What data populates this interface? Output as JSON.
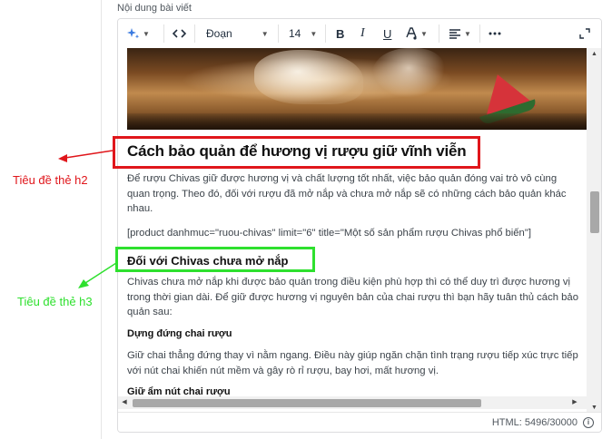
{
  "field": {
    "label": "Nội dung bài viết"
  },
  "toolbar": {
    "block_format": "Đoạn",
    "font_size": "14",
    "bold": "B",
    "italic": "I",
    "underline": "U",
    "icons": [
      "ai-assistant-icon",
      "source-code-icon",
      "text-color-icon",
      "align-icon",
      "more-icon",
      "fullscreen-icon"
    ]
  },
  "article": {
    "heading_h2": "Cách bảo quản để hương vị rượu giữ vĩnh viễn",
    "para1": "Để rượu Chivas giữ được hương vị và chất lượng tốt nhất, việc bảo quản đóng vai trò vô cùng quan trọng. Theo đó, đối với rượu đã mở nắp và chưa mở nắp sẽ có những cách bảo quản khác nhau.",
    "shortcode": "[product danhmuc=\"ruou-chivas\" limit=\"6\" title=\"Một số sản phẩm rượu  Chivas phổ biến\"]",
    "heading_h3": "Đối với Chivas chưa mở nắp",
    "para2": "Chivas chưa mở nắp khi được bảo quản trong điều kiện phù hợp thì có thể duy trì được hương vị trong thời gian dài. Để giữ được hương vị nguyên bản của chai rượu thì bạn hãy tuân thủ cách bảo quản sau:",
    "heading_h4a": "Dựng đứng chai rượu",
    "para3": "Giữ chai thẳng đứng thay vì nằm ngang. Điều này giúp ngăn chặn tình trạng rượu tiếp xúc trực tiếp với nút chai khiến nút mềm và gây rò rỉ rượu, bay hơi, mất hương vị.",
    "heading_h4b": "Giữ ẩm nút chai rượu"
  },
  "status": {
    "html_count": "HTML: 5496/30000"
  },
  "annotations": {
    "h2_label": "Tiêu đề thẻ h2",
    "h3_label": "Tiêu đề thẻ h3",
    "h2_color": "#e0161b",
    "h3_color": "#2ee02e"
  }
}
